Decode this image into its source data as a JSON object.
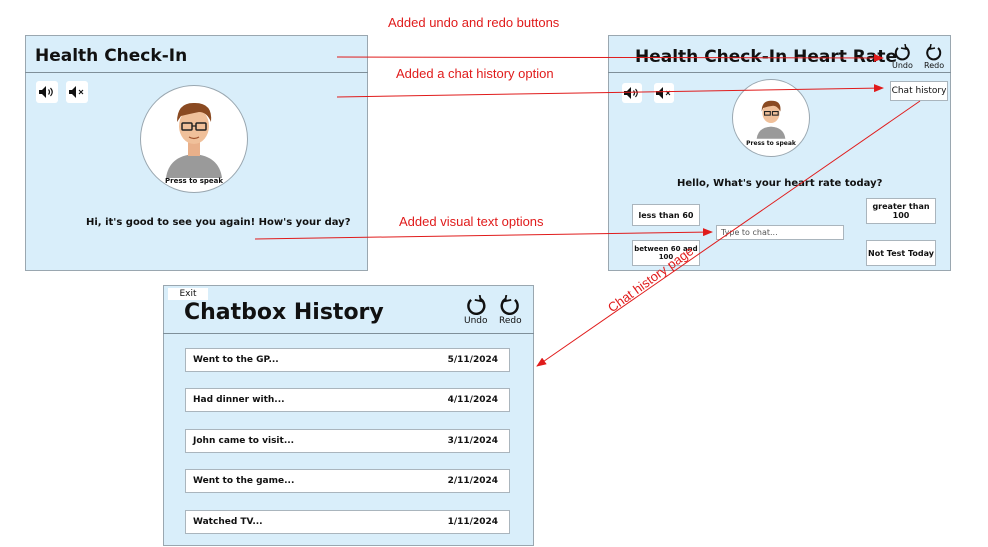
{
  "colors": {
    "panel_bg": "#d9eefa",
    "arrow": "#e01b1b",
    "border": "#9aa7b0"
  },
  "screen1": {
    "title": "Health Check-In",
    "press_to_speak": "Press to speak",
    "greeting": "Hi, it's good to see you again! How's your day?",
    "icons": [
      "speaker-icon",
      "mute-icon"
    ]
  },
  "screen2": {
    "title": "Health Check-In Heart Rate",
    "undo_label": "Undo",
    "redo_label": "Redo",
    "chat_history": "Chat history",
    "press_to_speak": "Press to speak",
    "question": "Hello, What's your heart rate today?",
    "options": [
      "less than 60",
      "greater than 100",
      "between 60 and 100",
      "Not Test Today"
    ],
    "chat_placeholder": "Type to chat..."
  },
  "screen3": {
    "exit_label": "Exit",
    "title": "Chatbox History",
    "undo_label": "Undo",
    "redo_label": "Redo",
    "entries": [
      {
        "text": "Went to the GP...",
        "date": "5/11/2024"
      },
      {
        "text": "Had dinner with...",
        "date": "4/11/2024"
      },
      {
        "text": "John came to visit...",
        "date": "3/11/2024"
      },
      {
        "text": "Went to the game...",
        "date": "2/11/2024"
      },
      {
        "text": "Watched TV...",
        "date": "1/11/2024"
      }
    ]
  },
  "annotations": {
    "undo_redo": "Added undo and redo buttons",
    "chat_history": "Added a chat history option",
    "visual_text": "Added visual text options",
    "history_page": "Chat history page"
  }
}
